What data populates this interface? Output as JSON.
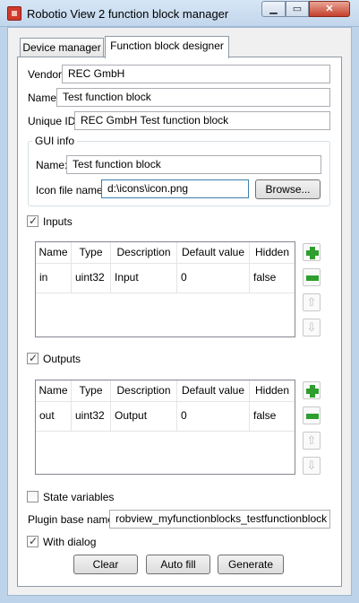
{
  "window": {
    "title": "Robotio View 2 function block manager"
  },
  "tabs": [
    {
      "label": "Device manager",
      "active": false
    },
    {
      "label": "Function block designer",
      "active": true
    }
  ],
  "form": {
    "vendor_label": "Vendor:",
    "vendor_value": "REC GmbH",
    "name_label": "Name:",
    "name_value": "Test function block",
    "unique_id_label": "Unique ID:",
    "unique_id_value": "REC GmbH Test function block",
    "gui_info": {
      "title": "GUI info",
      "name_label": "Name:",
      "name_value": "Test function block",
      "icon_label": "Icon file name:",
      "icon_value": "d:\\icons\\icon.png",
      "browse_button": "Browse..."
    },
    "inputs": {
      "label": "Inputs",
      "checked": true,
      "columns": [
        "Name",
        "Type",
        "Description",
        "Default value",
        "Hidden"
      ],
      "rows": [
        [
          "in",
          "uint32",
          "Input",
          "0",
          "false"
        ]
      ]
    },
    "outputs": {
      "label": "Outputs",
      "checked": true,
      "columns": [
        "Name",
        "Type",
        "Description",
        "Default value",
        "Hidden"
      ],
      "rows": [
        [
          "out",
          "uint32",
          "Output",
          "0",
          "false"
        ]
      ]
    },
    "state_variables": {
      "label": "State variables",
      "checked": false
    },
    "plugin_base_name_label": "Plugin base name:",
    "plugin_base_name_value": "robview_myfunctionblocks_testfunctionblock",
    "with_dialog": {
      "label": "With dialog",
      "checked": true
    },
    "buttons": {
      "clear": "Clear",
      "auto_fill": "Auto fill",
      "generate": "Generate"
    }
  },
  "icons": {
    "add": "plus-icon",
    "remove": "minus-icon",
    "move_up": "arrow-up-icon",
    "move_down": "arrow-down-icon"
  },
  "colors": {
    "accent_green": "#2e9e2e",
    "titlebar": "#c8dbef",
    "close_button": "#c4412d"
  }
}
